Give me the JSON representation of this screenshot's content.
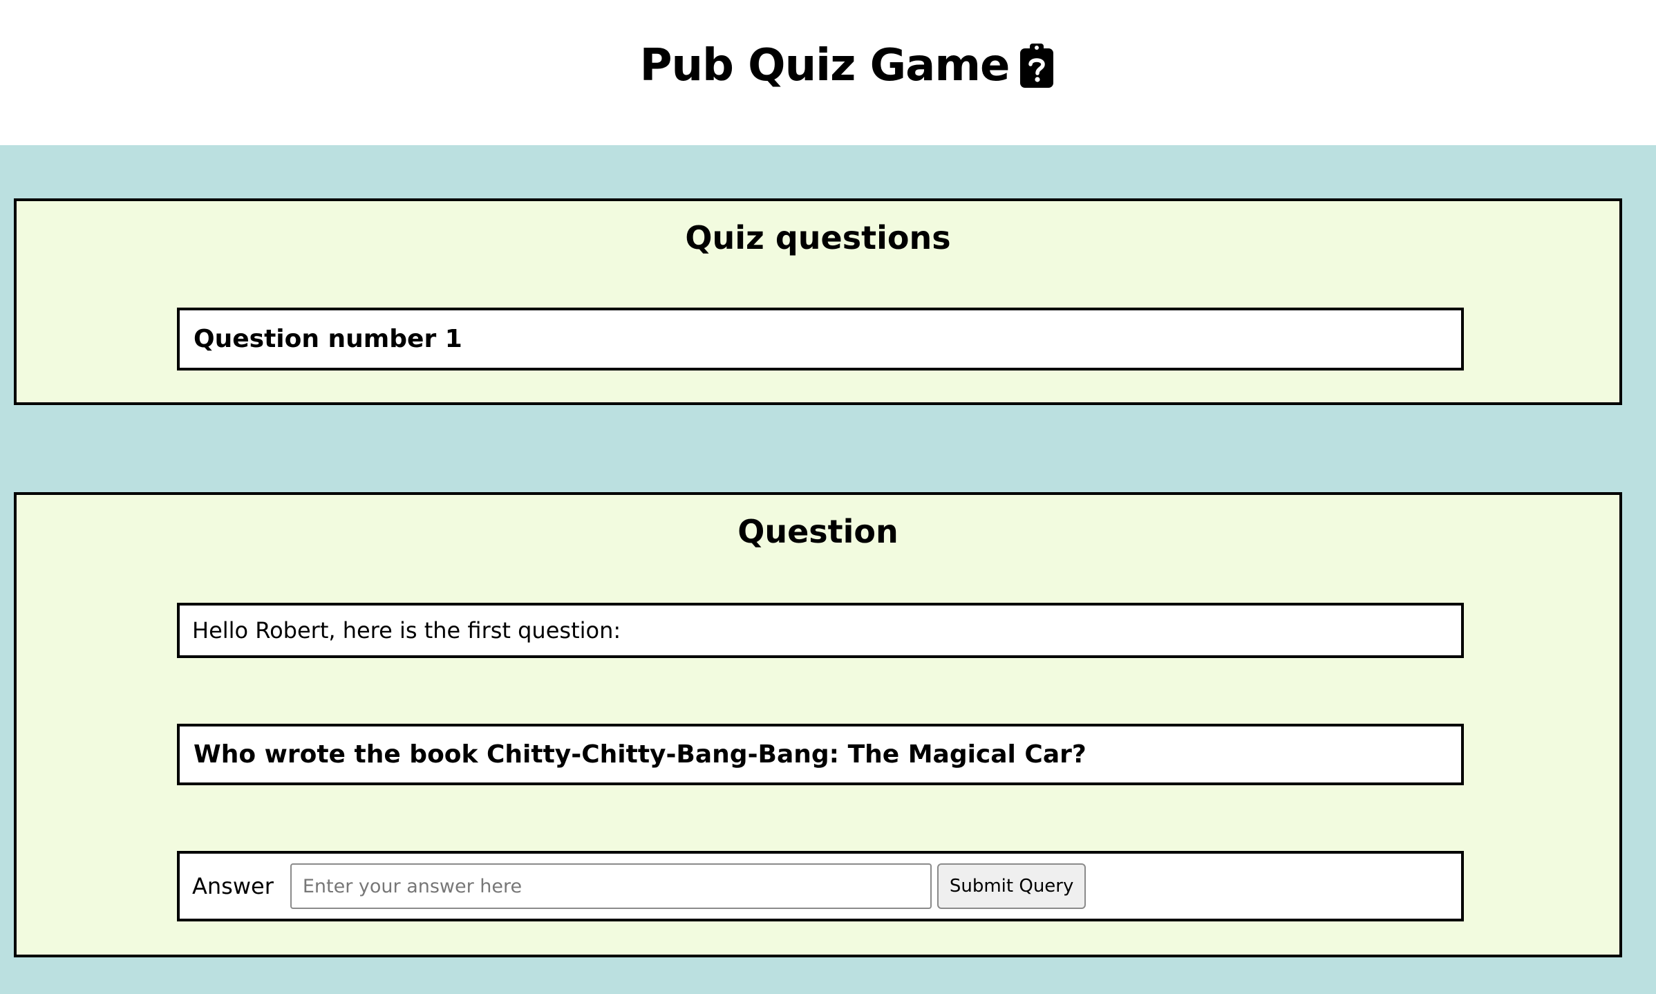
{
  "header": {
    "title": "Pub Quiz Game",
    "icon": "clipboard-question-icon"
  },
  "colors": {
    "page_background": "#bbe0e0",
    "panel_background": "#f2fbdf",
    "box_background": "#ffffff",
    "border": "#000000"
  },
  "quiz_panel": {
    "heading": "Quiz questions",
    "question_number": "Question number 1"
  },
  "question_panel": {
    "heading": "Question",
    "greeting": "Hello Robert, here is the first question:",
    "question_text": "Who wrote the book Chitty-Chitty-Bang-Bang: The Magical Car?",
    "answer": {
      "label": "Answer",
      "placeholder": "Enter your answer here",
      "value": "",
      "submit_label": "Submit Query"
    }
  }
}
